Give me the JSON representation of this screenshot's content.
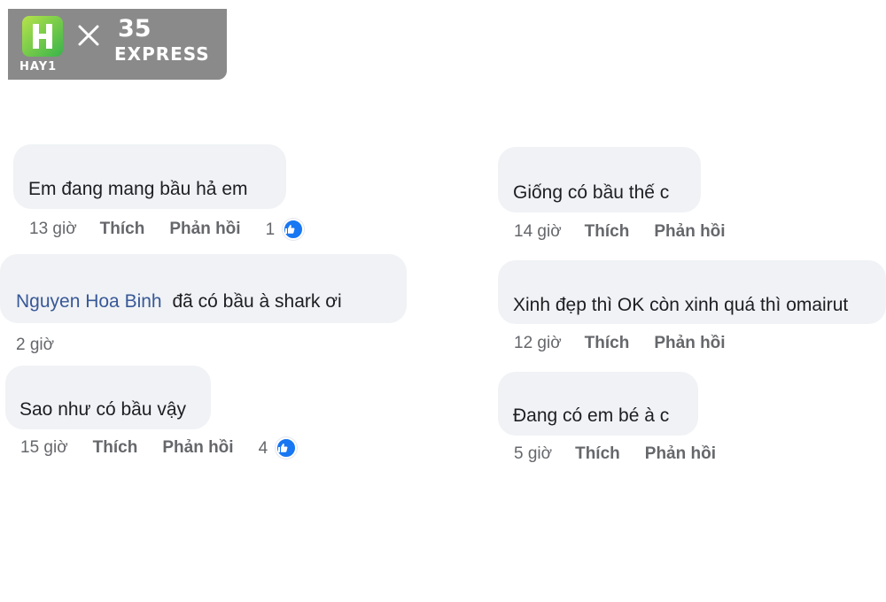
{
  "watermark": {
    "brand_letter": "H",
    "brand_name": "HAY1",
    "separator": "×",
    "partner_number": "35",
    "partner_name": "EXPRESS",
    "brand_color_start": "#b7e34b",
    "brand_color_end": "#38b44a",
    "background": "#8a8a8a"
  },
  "comments_left": [
    {
      "author": "",
      "text": "Em đang mang bầu hả em",
      "time": "13 giờ",
      "like_label": "Thích",
      "reply_label": "Phản hồi",
      "reaction_count": "1",
      "reaction_icon": "like-icon"
    },
    {
      "author": "Nguyen Hoa Binh",
      "text": "đã có bầu à shark ơi",
      "time": "2 giờ",
      "like_label": "",
      "reply_label": "",
      "reaction_count": "",
      "reaction_icon": ""
    },
    {
      "author": "",
      "text": "Sao như có bầu vậy",
      "time": "15 giờ",
      "like_label": "Thích",
      "reply_label": "Phản hồi",
      "reaction_count": "4",
      "reaction_icon": "like-icon"
    }
  ],
  "comments_right": [
    {
      "text": "Giống có bầu thế c",
      "time": "14 giờ",
      "like_label": "Thích",
      "reply_label": "Phản hồi"
    },
    {
      "text": "Xinh đẹp thì OK còn xinh quá thì omairut",
      "time": "12 giờ",
      "like_label": "Thích",
      "reply_label": "Phản hồi"
    },
    {
      "text": "Đang có em bé à c",
      "time": "5 giờ",
      "like_label": "Thích",
      "reply_label": "Phản hồi"
    }
  ],
  "colors": {
    "bubble": "#f0f2f5",
    "author_link": "#385898",
    "meta_text": "#65676b",
    "like_blue": "#1877f2"
  }
}
